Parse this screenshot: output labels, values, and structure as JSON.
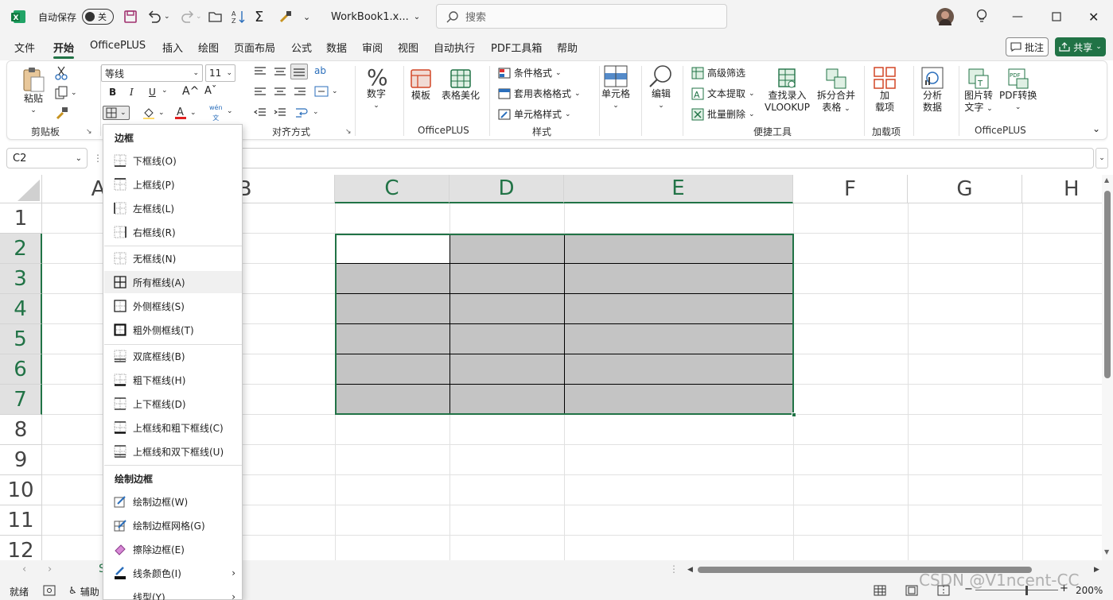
{
  "titlebar": {
    "autosave_label": "自动保存",
    "autosave_state": "关",
    "filename": "WorkBook1.x...",
    "search_placeholder": "搜索"
  },
  "menu": {
    "tabs": [
      "文件",
      "开始",
      "OfficePLUS",
      "插入",
      "绘图",
      "页面布局",
      "公式",
      "数据",
      "审阅",
      "视图",
      "自动执行",
      "PDF工具箱",
      "帮助"
    ],
    "active_tab": "开始",
    "comment_label": "批注",
    "share_label": "共享"
  },
  "ribbon": {
    "clipboard": {
      "paste": "粘贴",
      "group": "剪贴板"
    },
    "font": {
      "name": "等线",
      "size": "11",
      "bold": "B",
      "italic": "I",
      "underline": "U",
      "grow": "A^",
      "shrink": "Aˇ",
      "wen": "wén"
    },
    "alignment": {
      "group": "对齐方式"
    },
    "number": {
      "label": "数字"
    },
    "officeplus1": {
      "template": "模板",
      "beautify": "表格美化",
      "group": "OfficePLUS"
    },
    "styles": {
      "conditional": "条件格式",
      "table_format": "套用表格格式",
      "cell_style": "单元格样式",
      "group": "样式"
    },
    "cells": {
      "label": "单元格"
    },
    "editing": {
      "label": "编辑"
    },
    "tools": {
      "adv_filter": "高级筛选",
      "text_extract": "文本提取",
      "batch_delete": "批量删除",
      "vlookup_1": "查找录入",
      "vlookup_2": "VLOOKUP",
      "split_1": "拆分合并",
      "split_2": "表格",
      "group": "便捷工具"
    },
    "addins": {
      "label_1": "加",
      "label_2": "载项",
      "group": "加载项"
    },
    "analyze": {
      "label_1": "分析",
      "label_2": "数据"
    },
    "officeplus2": {
      "img2text_1": "图片转",
      "img2text_2": "文字",
      "pdf_1": "PDF转换",
      "group": "OfficePLUS"
    }
  },
  "formula": {
    "namebox": "C2"
  },
  "grid": {
    "columns": [
      "A",
      "B",
      "C",
      "D",
      "E",
      "F",
      "G",
      "H"
    ],
    "rows": [
      "1",
      "2",
      "3",
      "4",
      "5",
      "6",
      "7",
      "8",
      "9",
      "10",
      "11",
      "12"
    ],
    "selected_columns": [
      "C",
      "D",
      "E"
    ],
    "selected_rows": [
      "2",
      "3",
      "4",
      "5",
      "6",
      "7"
    ]
  },
  "dropdown": {
    "header_borders": "边框",
    "items1": [
      "下框线(O)",
      "上框线(P)",
      "左框线(L)",
      "右框线(R)"
    ],
    "items2": [
      "无框线(N)",
      "所有框线(A)",
      "外侧框线(S)",
      "粗外侧框线(T)"
    ],
    "items3": [
      "双底框线(B)",
      "粗下框线(H)",
      "上下框线(D)",
      "上框线和粗下框线(C)",
      "上框线和双下框线(U)"
    ],
    "header_draw": "绘制边框",
    "items4": [
      "绘制边框(W)",
      "绘制边框网格(G)",
      "擦除边框(E)",
      "线条颜色(I)",
      "线型(Y)"
    ]
  },
  "status": {
    "ready": "就绪",
    "accessibility": "辅助",
    "zoom": "200%",
    "sheet_tab_partial": "S"
  },
  "watermark": "CSDN @V1ncent-CC",
  "colors": {
    "accent": "#217346",
    "selection_fill": "#c4c4c4"
  }
}
